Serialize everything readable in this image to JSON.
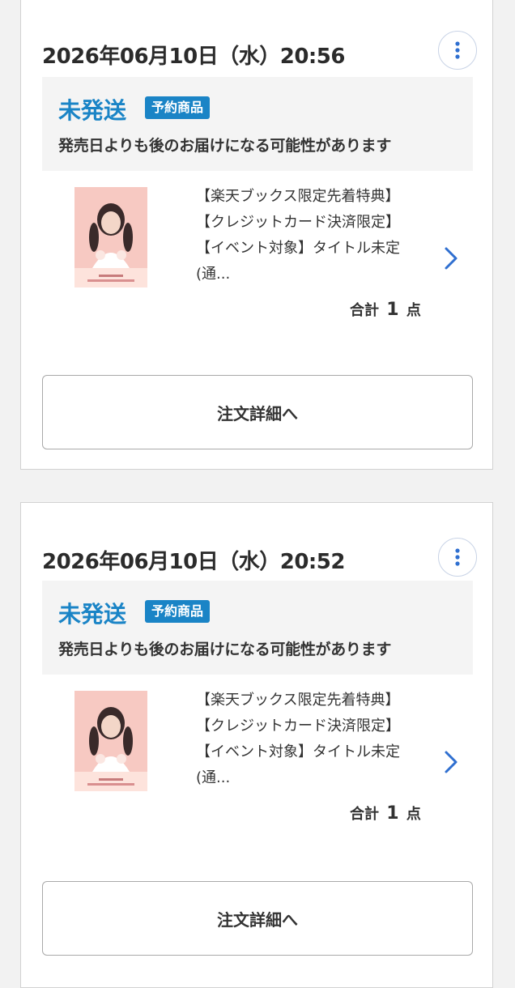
{
  "orders": [
    {
      "date": "2026年06月10日（水）20:56",
      "status": "未発送",
      "badge": "予約商品",
      "note": "発売日よりも後のお届けになる可能性があります",
      "product": {
        "line1": "【楽天ブックス限定先着特典】",
        "line2": "【クレジットカード決済限定】",
        "line3": "【イベント対象】タイトル未定",
        "line4": "(通..."
      },
      "total_prefix": "合計",
      "total_count": "1",
      "total_suffix": "点",
      "detail_label": "注文詳細へ"
    },
    {
      "date": "2026年06月10日（水）20:52",
      "status": "未発送",
      "badge": "予約商品",
      "note": "発売日よりも後のお届けになる可能性があります",
      "product": {
        "line1": "【楽天ブックス限定先着特典】",
        "line2": "【クレジットカード決済限定】",
        "line3": "【イベント対象】タイトル未定",
        "line4": "(通..."
      },
      "total_prefix": "合計",
      "total_count": "1",
      "total_suffix": "点",
      "detail_label": "注文詳細へ"
    }
  ],
  "colors": {
    "accent": "#1a84c6",
    "chevron": "#2f6fd0",
    "page_bg": "#f2f2f2"
  },
  "icons": {
    "menu": "more-vertical-icon",
    "chevron": "chevron-right-icon",
    "thumbnail": "product-photo"
  }
}
